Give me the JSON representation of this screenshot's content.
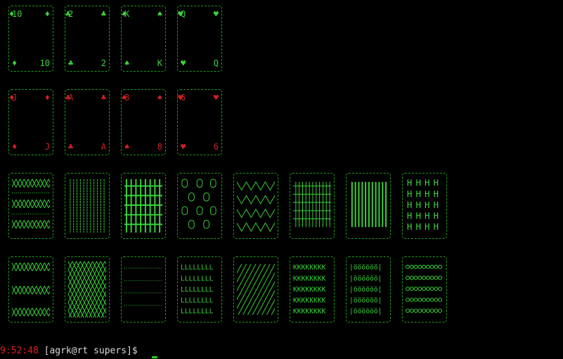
{
  "colors": {
    "background": "#000000",
    "card_outline": "#1f9a1f",
    "green_suit": "#3ad43a",
    "red_suit": "#d42020",
    "cursor": "#22c822"
  },
  "face_cards": [
    {
      "rank": "10",
      "suit": "♦",
      "suit_icon": "diamond-icon",
      "color": "green"
    },
    {
      "rank": "2",
      "suit": "♣",
      "suit_icon": "club-icon",
      "color": "green"
    },
    {
      "rank": "K",
      "suit": "♠",
      "suit_icon": "spade-icon",
      "color": "green"
    },
    {
      "rank": "Q",
      "suit": "♥",
      "suit_icon": "heart-icon",
      "color": "green"
    },
    {
      "rank": "J",
      "suit": "♦",
      "suit_icon": "diamond-icon",
      "color": "red"
    },
    {
      "rank": "A",
      "suit": "♣",
      "suit_icon": "club-icon",
      "color": "red"
    },
    {
      "rank": "8",
      "suit": "♠",
      "suit_icon": "spade-icon",
      "color": "red"
    },
    {
      "rank": "6",
      "suit": "♥",
      "suit_icon": "heart-icon",
      "color": "red"
    }
  ],
  "card_backs": [
    {
      "name": "card-back-x-rows"
    },
    {
      "name": "card-back-vertical-lines"
    },
    {
      "name": "card-back-bold-grid"
    },
    {
      "name": "card-back-ovals"
    },
    {
      "name": "card-back-zigzag"
    },
    {
      "name": "card-back-fence"
    },
    {
      "name": "card-back-vertical-bars"
    },
    {
      "name": "card-back-h-letters"
    },
    {
      "name": "card-back-x-bands"
    },
    {
      "name": "card-back-crosshatch"
    },
    {
      "name": "card-back-dotted-lines"
    },
    {
      "name": "card-back-l-letters"
    },
    {
      "name": "card-back-diagonals"
    },
    {
      "name": "card-back-k-letters"
    },
    {
      "name": "card-back-o-umlauts"
    },
    {
      "name": "card-back-circle-chain"
    }
  ],
  "prompt": {
    "time": "9:52:48",
    "text": " [agrk@rt supers]$ "
  }
}
